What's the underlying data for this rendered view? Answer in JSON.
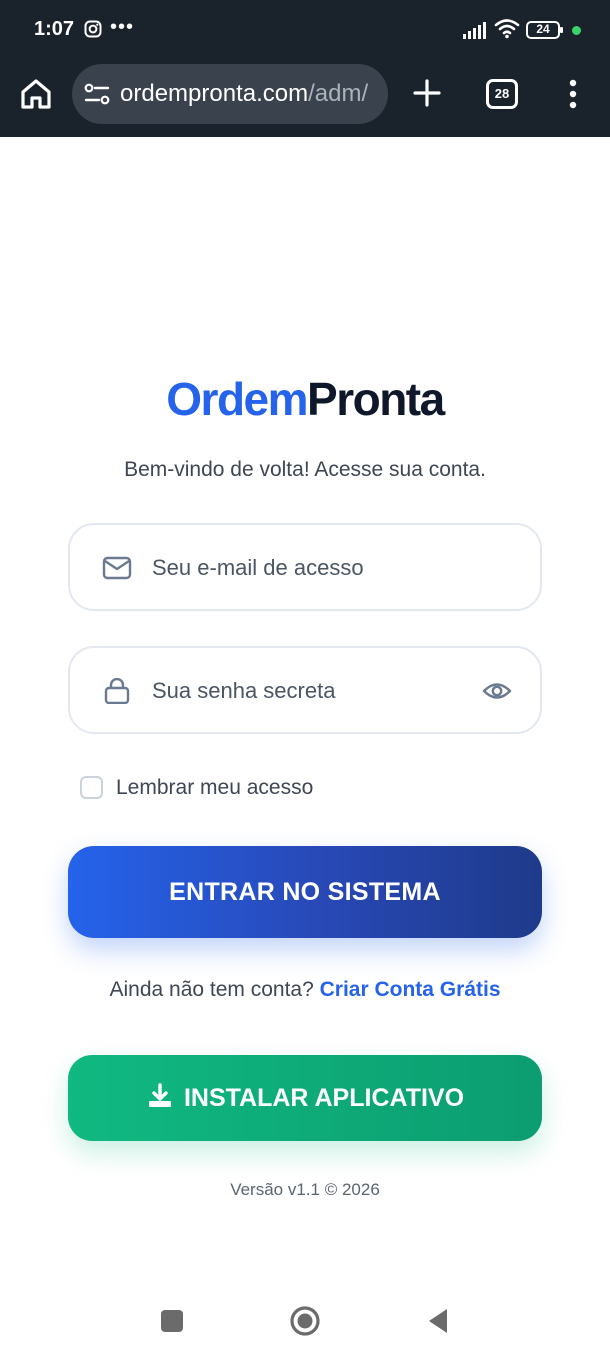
{
  "status_bar": {
    "time": "1:07",
    "battery": "24",
    "icons": [
      "instagram-icon",
      "more-dots-icon",
      "signal-icon",
      "wifi-icon",
      "battery-icon",
      "camera-indicator-icon"
    ]
  },
  "browser": {
    "url_host": "ordempronta.com",
    "url_path": "/adm/",
    "tab_count": "28",
    "icons": [
      "home-icon",
      "site-settings-icon",
      "plus-icon",
      "menu-dots-icon"
    ]
  },
  "page": {
    "logo_part1": "Ordem",
    "logo_part2": "Pronta",
    "subtitle": "Bem-vindo de volta! Acesse sua conta.",
    "email_placeholder": "Seu e-mail de acesso",
    "password_placeholder": "Sua senha secreta",
    "remember_label": "Lembrar meu acesso",
    "login_button": "ENTRAR NO SISTEMA",
    "signup_prompt": "Ainda não tem conta?",
    "signup_link": "Criar Conta Grátis",
    "install_button": "INSTALAR APLICATIVO",
    "version": "Versão v1.1 © 2026"
  },
  "colors": {
    "brand_blue": "#2563eb",
    "brand_dark": "#0f172a",
    "install_green": "#10b981",
    "chrome_bg": "#1a222c"
  },
  "nav_bar": {
    "icons": [
      "recents-icon",
      "home-circle-icon",
      "back-icon"
    ]
  }
}
